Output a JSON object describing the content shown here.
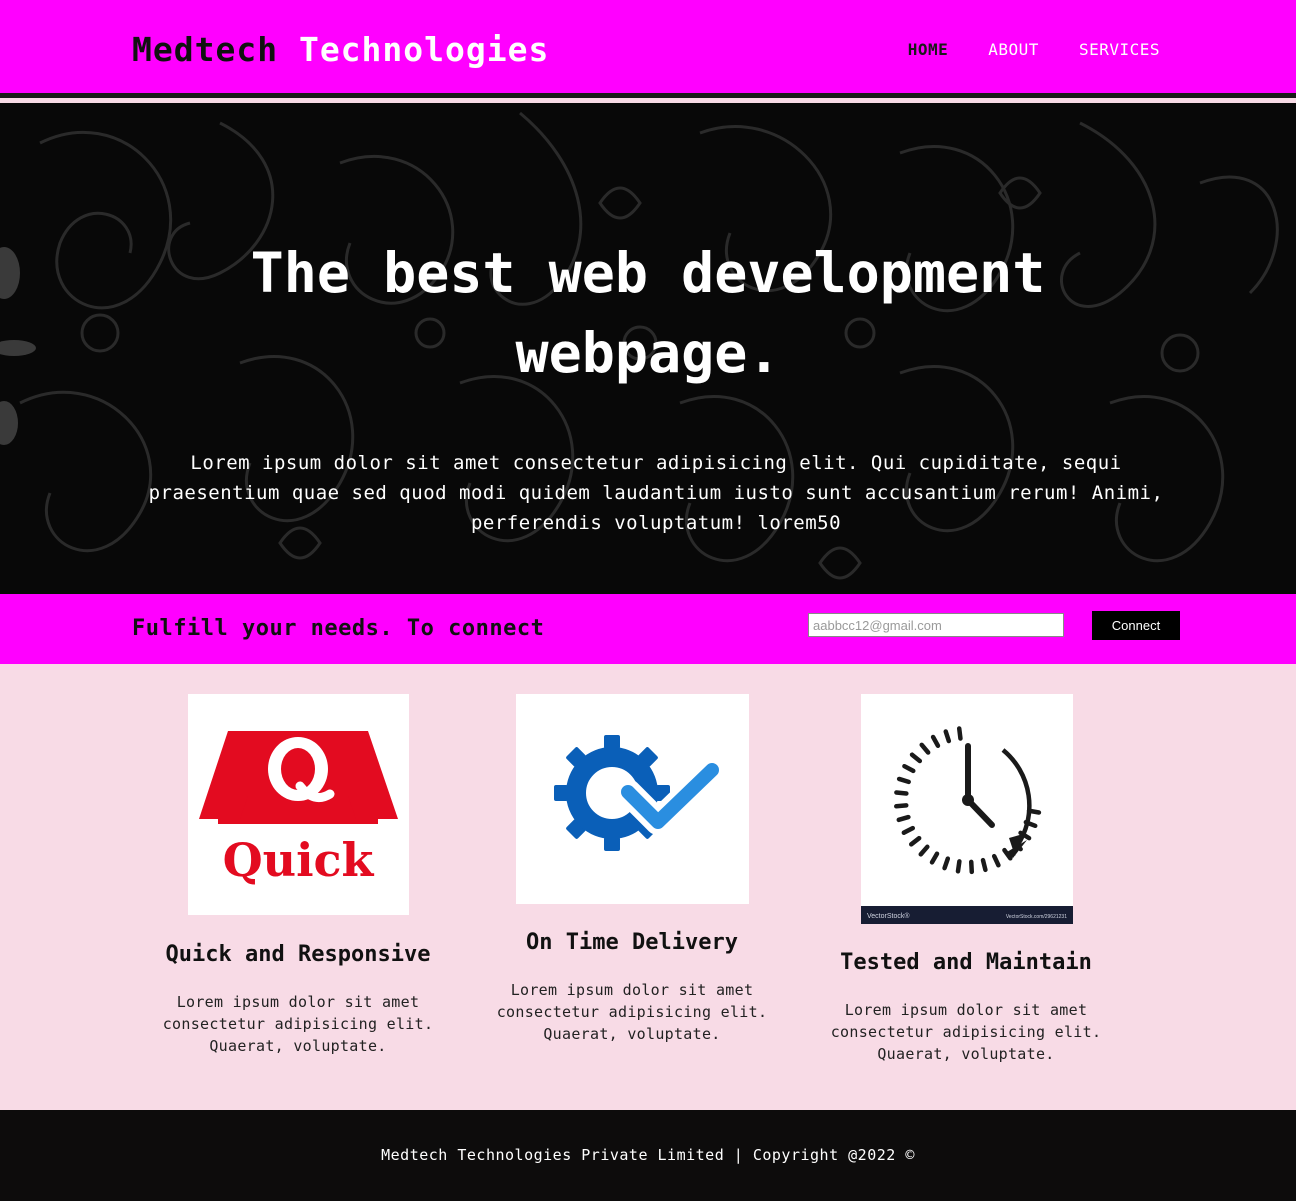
{
  "header": {
    "brand_part1": "Medtech",
    "brand_part2": " Technologies",
    "nav": [
      {
        "label": "HOME"
      },
      {
        "label": "ABOUT"
      },
      {
        "label": "SERVICES"
      }
    ]
  },
  "hero": {
    "title": "The best web development webpage.",
    "text": "Lorem ipsum dolor sit amet consectetur adipisicing elit. Qui cupiditate, sequi praesentium quae sed quod modi quidem laudantium iusto sunt accusantium rerum! Animi, perferendis voluptatum! lorem50"
  },
  "connect": {
    "text": "Fulfill your needs. To connect",
    "email_placeholder": "aabbcc12@gmail.com",
    "button_label": "Connect"
  },
  "features": [
    {
      "title": "Quick and Responsive",
      "text": "Lorem ipsum dolor sit amet consectetur adipisicing elit. Quaerat, voluptate.",
      "logo_text": "Quick",
      "logo_letter": "Q"
    },
    {
      "title": "On Time Delivery",
      "text": "Lorem ipsum dolor sit amet consectetur adipisicing elit. Quaerat, voluptate."
    },
    {
      "title": "Tested and Maintain",
      "text": "Lorem ipsum dolor sit amet consectetur adipisicing elit. Quaerat, voluptate.",
      "watermark_left": "VectorStock®",
      "watermark_right": "VectorStock.com/29621231"
    }
  ],
  "footer": {
    "text": "Medtech Technologies Private Limited | Copyright @2022 ©"
  },
  "colors": {
    "magenta": "#ff00ff",
    "hero_bg": "#080808",
    "body_bg": "#f8dbe6",
    "footer_bg": "#0d0c0c",
    "quick_red": "#e30b20",
    "delivery_blue": "#0a5fb8"
  }
}
